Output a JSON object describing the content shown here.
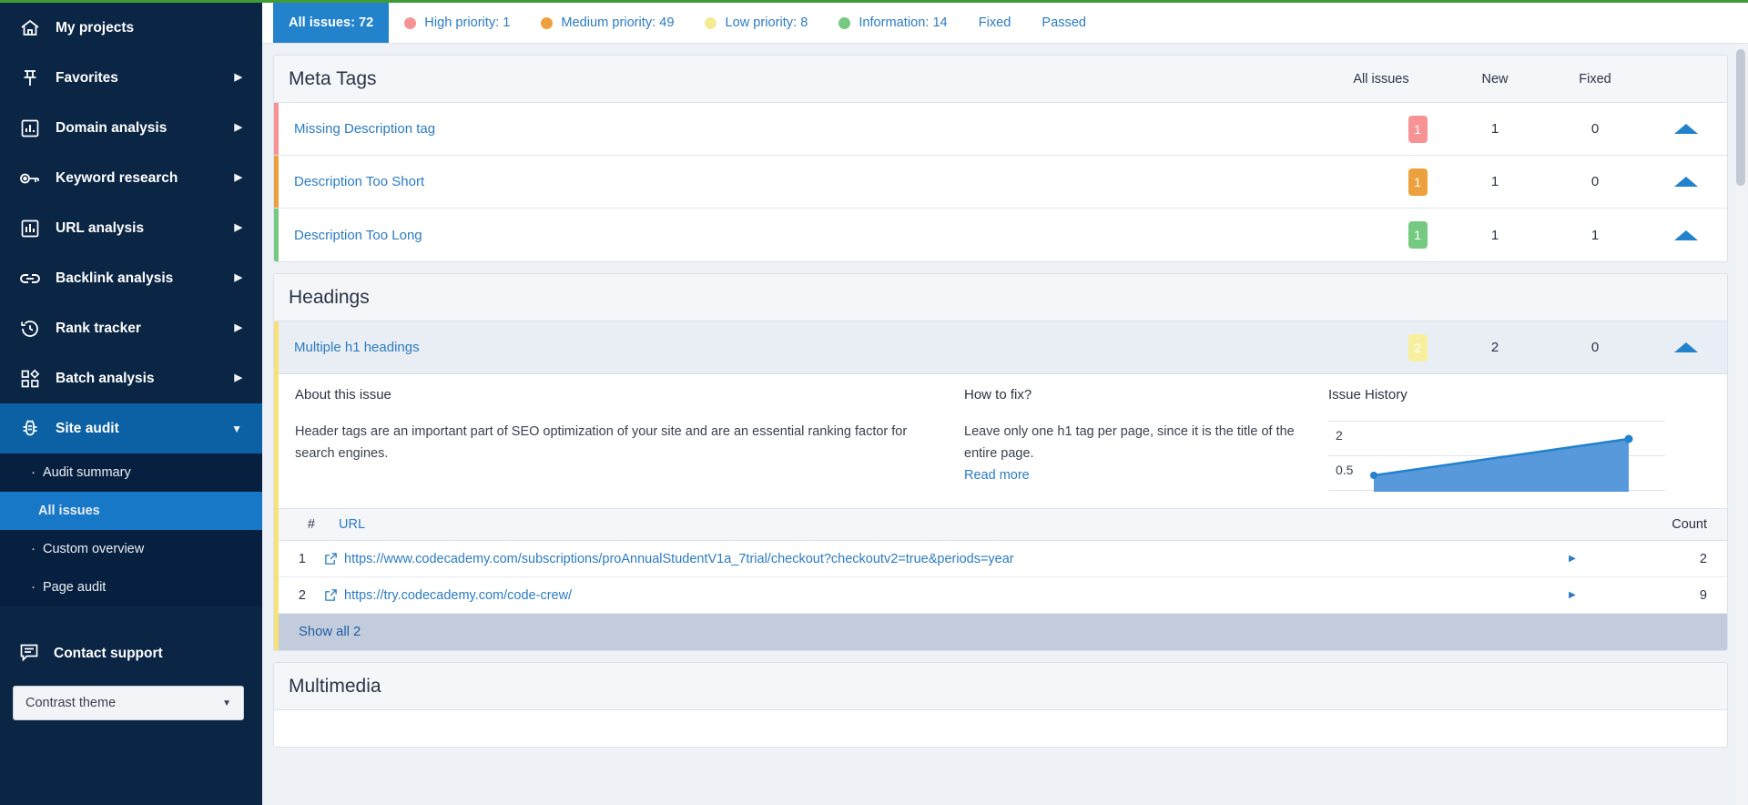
{
  "sidebar": {
    "items": [
      {
        "label": "My projects",
        "icon": "home-icon",
        "caret": false
      },
      {
        "label": "Favorites",
        "icon": "pin-icon",
        "caret": true
      },
      {
        "label": "Domain analysis",
        "icon": "chart-box-icon",
        "caret": true
      },
      {
        "label": "Keyword research",
        "icon": "key-icon",
        "caret": true
      },
      {
        "label": "URL analysis",
        "icon": "bar-chart-icon",
        "caret": true
      },
      {
        "label": "Backlink analysis",
        "icon": "link-icon",
        "caret": true
      },
      {
        "label": "Rank tracker",
        "icon": "clock-back-icon",
        "caret": true
      },
      {
        "label": "Batch analysis",
        "icon": "grid-icon",
        "caret": true
      },
      {
        "label": "Site audit",
        "icon": "bug-icon",
        "caret": true,
        "active": true
      }
    ],
    "sub_items": [
      {
        "label": "Audit summary",
        "active": false
      },
      {
        "label": "All issues",
        "active": true
      },
      {
        "label": "Custom overview",
        "active": false
      },
      {
        "label": "Page audit",
        "active": false
      }
    ],
    "support_label": "Contact support",
    "support_icon": "chat-icon",
    "theme_label": "Contrast theme",
    "theme_caret_icon": "chevron-down-icon"
  },
  "tabs": [
    {
      "label": "All issues: 72",
      "active": true,
      "dot": null
    },
    {
      "label": "High priority: 1",
      "active": false,
      "dot": "#f79394"
    },
    {
      "label": "Medium priority: 49",
      "active": false,
      "dot": "#eda13e"
    },
    {
      "label": "Low priority: 8",
      "active": false,
      "dot": "#f4eb92"
    },
    {
      "label": "Information: 14",
      "active": false,
      "dot": "#76c981"
    },
    {
      "label": "Fixed",
      "active": false,
      "dot": null
    },
    {
      "label": "Passed",
      "active": false,
      "dot": null
    }
  ],
  "columns": {
    "all_issues": "All issues",
    "new": "New",
    "fixed": "Fixed"
  },
  "cards": [
    {
      "title": "Meta Tags",
      "rows": [
        {
          "name": "Missing Description tag",
          "badge": "1",
          "badge_color": "#f79394",
          "bar_color": "#f79394",
          "all": "1",
          "new": "1",
          "fixed": "0",
          "caret_icon": "triangle-up-icon"
        },
        {
          "name": "Description Too Short",
          "badge": "1",
          "badge_color": "#eda13e",
          "bar_color": "#eda13e",
          "all": "1",
          "new": "1",
          "fixed": "0",
          "caret_icon": "triangle-up-icon"
        },
        {
          "name": "Description Too Long",
          "badge": "1",
          "badge_color": "#76c981",
          "bar_color": "#76c981",
          "all": "1",
          "new": "1",
          "fixed": "1",
          "caret_icon": "triangle-up-icon"
        }
      ]
    }
  ],
  "headings_card": {
    "title": "Headings",
    "issue": {
      "name": "Multiple h1 headings",
      "badge": "2",
      "badge_color": "#f7ef9e",
      "bar_color": "#f6e27a",
      "all": "2",
      "new": "2",
      "fixed": "0",
      "caret_icon": "triangle-up-icon"
    },
    "about_title": "About this issue",
    "about_text": "Header tags are an important part of SEO optimization of your site and are an essential ranking factor for search engines.",
    "howto_title": "How to fix?",
    "howto_text": "Leave only one h1 tag per page, since it is the title of the entire page.",
    "readmore": "Read more",
    "history_title": "Issue History",
    "url_table": {
      "col_idx": "#",
      "col_url": "URL",
      "col_count": "Count",
      "rows": [
        {
          "idx": "1",
          "url": "https://www.codecademy.com/subscriptions/proAnnualStudentV1a_7trial/checkout?checkoutv2=true&periods=year",
          "count": "2",
          "link_icon": "external-link-icon",
          "arrow_icon": "triangle-right-icon"
        },
        {
          "idx": "2",
          "url": "https://try.codecademy.com/code-crew/",
          "count": "9",
          "link_icon": "external-link-icon",
          "arrow_icon": "triangle-right-icon"
        }
      ],
      "show_all": "Show all 2"
    }
  },
  "multimedia_card": {
    "title": "Multimedia"
  },
  "chart_data": {
    "type": "area",
    "title": "Issue History",
    "x": [
      0,
      1
    ],
    "values": [
      0.5,
      2
    ],
    "yticks": [
      2,
      0.5
    ],
    "ytick_labels": [
      "2",
      "0.5"
    ],
    "ylim": [
      0,
      2.4
    ],
    "grid": true,
    "legend": "none",
    "line_color": "#2282cc",
    "fill_color": "#4a90d9",
    "xlabel": "",
    "ylabel": ""
  }
}
